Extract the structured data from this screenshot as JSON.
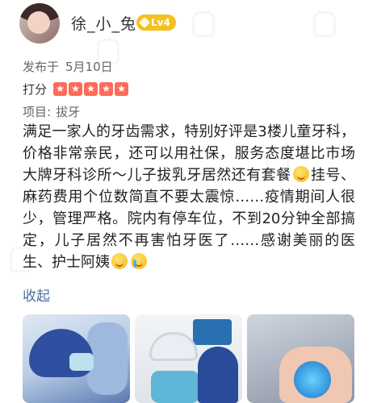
{
  "user": {
    "name": "徐_小_兔",
    "level": "Lv4"
  },
  "post": {
    "published_label": "发布于",
    "published_date": "5月10日"
  },
  "rating": {
    "label": "打分",
    "stars": 5,
    "max_stars": 5
  },
  "project": {
    "label": "项目:",
    "value": "拔牙"
  },
  "review": {
    "part1": "满足一家人的牙齿需求，特别好评是3楼儿童牙科，价格非常亲民，还可以用社保，服务态度堪比市场大牌牙科诊所～儿子拔乳牙居然还有套餐",
    "part2": "挂号、麻药费用个位数简直不要太震惊……疫情期间人很少，管理严格。院内有停车位，不到20分钟全部搞定，儿子居然不再害怕牙医了……感谢美丽的医生、护士阿姨",
    "emojis": [
      "smiling-face-icon",
      "smiling-face-icon",
      "crying-face-icon"
    ]
  },
  "collapse_label": "收起",
  "colors": {
    "star": "#ff6b5a",
    "level_badge": "#f5c11f",
    "link": "#4a6ea3"
  },
  "photos": [
    "dentist-photo-1",
    "dentist-photo-2",
    "dentist-photo-3"
  ]
}
